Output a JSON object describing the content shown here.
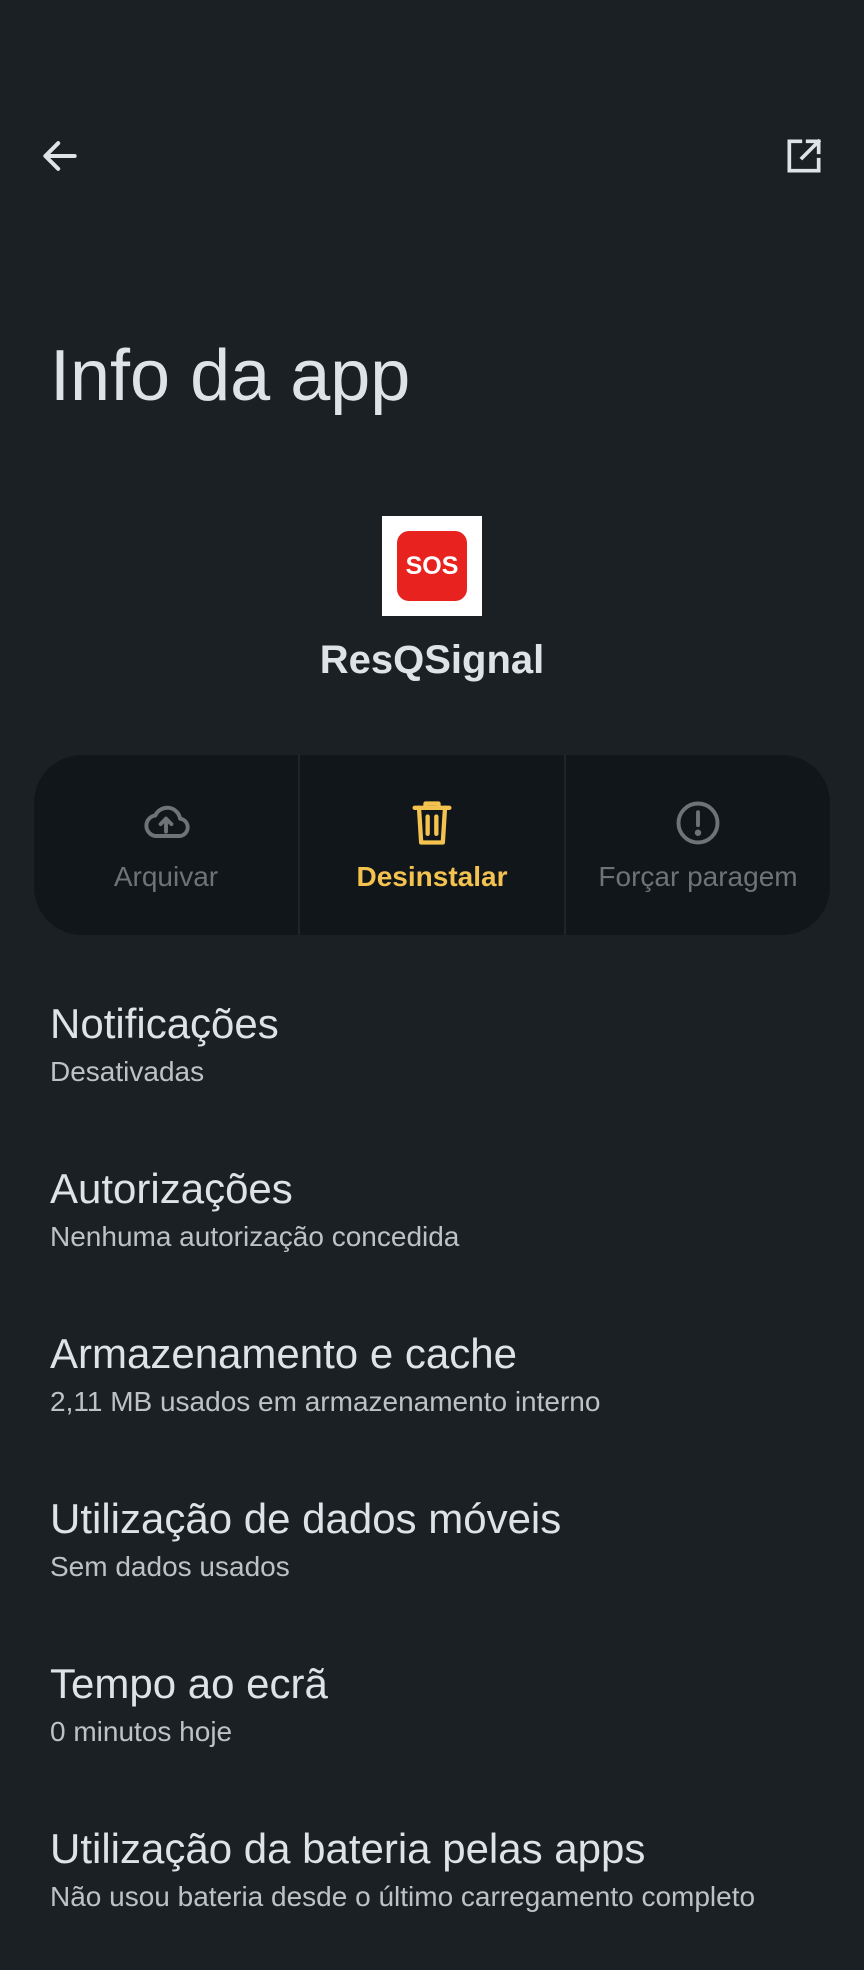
{
  "header": {
    "back_icon": "arrow-back-icon",
    "open_icon": "open-in-new-icon",
    "title": "Info da app"
  },
  "app": {
    "icon_text": "SOS",
    "name": "ResQSignal",
    "icon_color": "#e8231f"
  },
  "actions": [
    {
      "label": "Arquivar",
      "icon": "cloud-upload-icon",
      "enabled": false
    },
    {
      "label": "Desinstalar",
      "icon": "trash-icon",
      "enabled": true
    },
    {
      "label": "Forçar paragem",
      "icon": "alert-circle-icon",
      "enabled": false
    }
  ],
  "settings": [
    {
      "title": "Notificações",
      "subtitle": "Desativadas"
    },
    {
      "title": "Autorizações",
      "subtitle": "Nenhuma autorização concedida"
    },
    {
      "title": "Armazenamento e cache",
      "subtitle": "2,11 MB usados em armazenamento interno"
    },
    {
      "title": "Utilização de dados móveis",
      "subtitle": "Sem dados usados"
    },
    {
      "title": "Tempo ao ecrã",
      "subtitle": "0 minutos hoje"
    },
    {
      "title": "Utilização da bateria pelas apps",
      "subtitle": "Não usou bateria desde o último carregamento completo"
    }
  ],
  "colors": {
    "background": "#1b2024",
    "accent": "#f3c24f",
    "disabled": "#6d7377"
  }
}
